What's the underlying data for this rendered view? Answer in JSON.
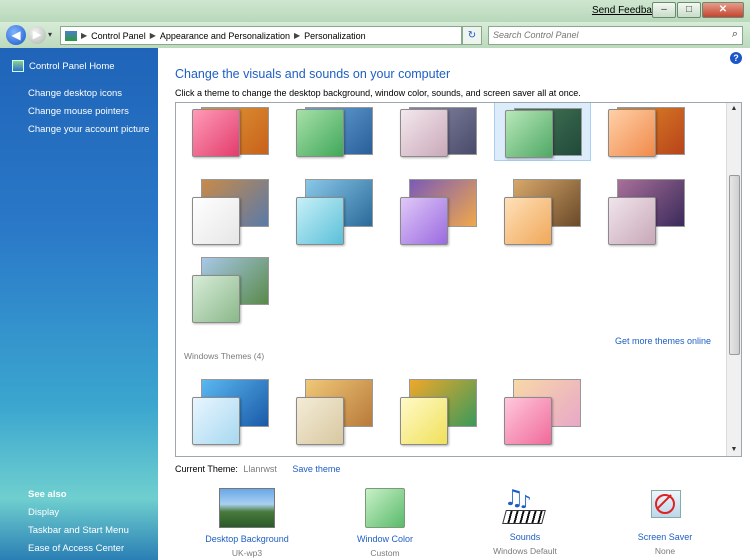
{
  "window": {
    "send_feedback": "Send Feedback"
  },
  "address": {
    "crumbs": [
      "Control Panel",
      "Appearance and Personalization",
      "Personalization"
    ],
    "search_placeholder": "Search Control Panel"
  },
  "sidebar": {
    "home": "Control Panel Home",
    "links": [
      "Change desktop icons",
      "Change mouse pointers",
      "Change your account picture"
    ],
    "see_also": "See also",
    "see_also_links": [
      "Display",
      "Taskbar and Start Menu",
      "Ease of Access Center"
    ]
  },
  "main": {
    "title": "Change the visuals and sounds on your computer",
    "description": "Click a theme to change the desktop background, window color, sounds, and screen saver all at once.",
    "more_themes": "Get more themes online",
    "windows_themes_header": "Windows Themes (4)",
    "current_theme_label": "Current Theme:",
    "current_theme_value": "Llanrwst",
    "save_theme": "Save theme"
  },
  "bottom": {
    "desktop_background": {
      "label": "Desktop Background",
      "sub": "UK-wp3"
    },
    "window_color": {
      "label": "Window Color",
      "sub": "Custom"
    },
    "sounds": {
      "label": "Sounds",
      "sub": "Windows Default"
    },
    "screen_saver": {
      "label": "Screen Saver",
      "sub": "None"
    }
  },
  "colors": {
    "link": "#1e5fc4",
    "sidebar_top": "#1f64b8",
    "sidebar_bottom": "#6fcfcf"
  }
}
